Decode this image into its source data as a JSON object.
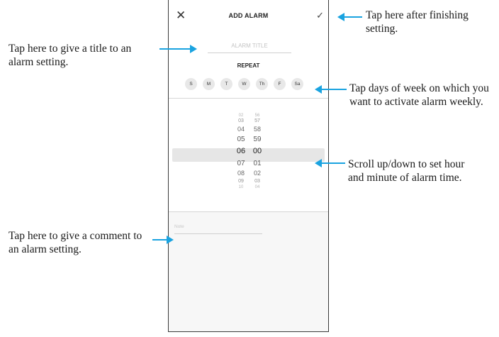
{
  "header": {
    "title": "ADD ALARM",
    "close_glyph": "✕",
    "confirm_glyph": "✓"
  },
  "alarm_title_placeholder": "ALARM TITLE",
  "repeat_label": "REPEAT",
  "days": [
    "S",
    "M",
    "T",
    "W",
    "Th",
    "F",
    "Sa"
  ],
  "picker": {
    "hours": [
      "02",
      "03",
      "04",
      "05",
      "06",
      "07",
      "08",
      "09",
      "10"
    ],
    "minutes": [
      "56",
      "57",
      "58",
      "59",
      "00",
      "01",
      "02",
      "03",
      "04"
    ],
    "selected_hour": "06",
    "selected_minute": "00"
  },
  "note_placeholder": "Note",
  "annotations": {
    "confirm": "Tap here after finishing setting.",
    "title": "Tap here to give a title to an alarm setting.",
    "days": "Tap days of week on which you want to activate alarm weekly.",
    "time": "Scroll up/down to set hour and minute of alarm time.",
    "note": "Tap here to give a comment to an alarm setting."
  },
  "colors": {
    "accent_arrow": "#1aa3e0",
    "selected_band": "#e6e6e6",
    "day_chip": "#e8e8e8"
  }
}
